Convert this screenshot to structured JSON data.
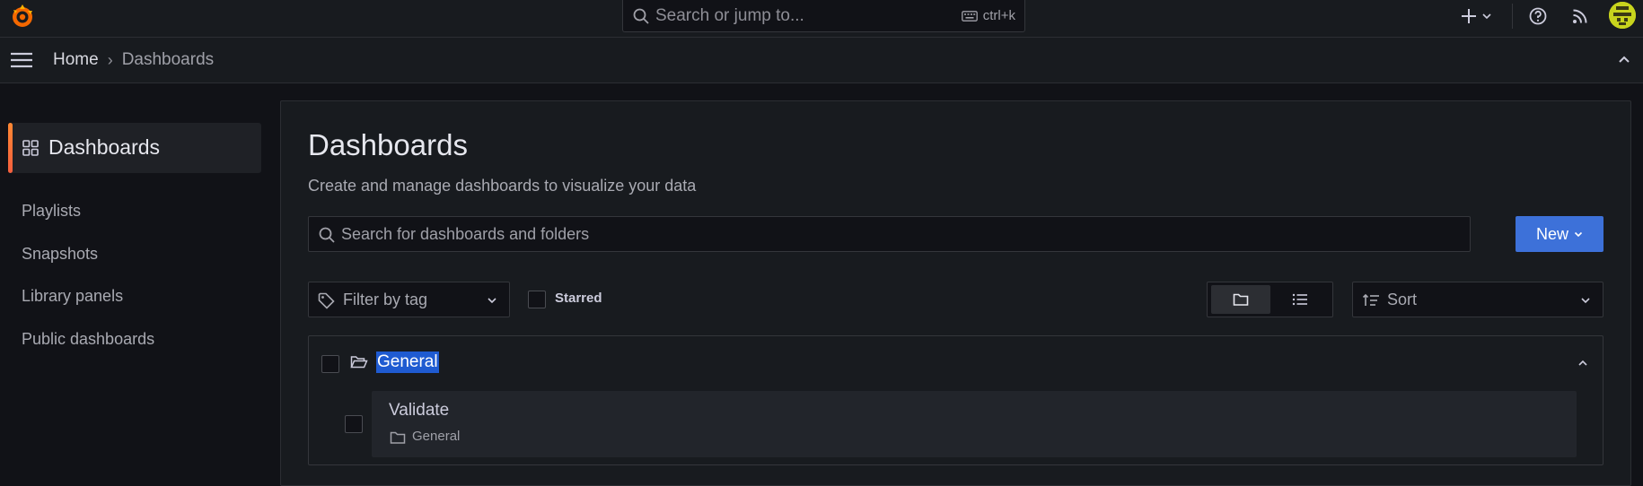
{
  "topbar": {
    "search_placeholder": "Search or jump to...",
    "shortcut": "ctrl+k",
    "icons": [
      "grafana-logo-icon",
      "keyboard-icon",
      "plus-icon",
      "help-icon",
      "rss-icon",
      "avatar"
    ]
  },
  "breadcrumb": {
    "home": "Home",
    "separator": "›",
    "current": "Dashboards"
  },
  "sidebar": {
    "active": "Dashboards",
    "items": [
      "Playlists",
      "Snapshots",
      "Library panels",
      "Public dashboards"
    ]
  },
  "main": {
    "title": "Dashboards",
    "subtitle": "Create and manage dashboards to visualize your data",
    "search_placeholder": "Search for dashboards and folders",
    "new_label": "New",
    "filter_tag_label": "Filter by tag",
    "starred_label": "Starred",
    "sort_label": "Sort",
    "view_mode": "folders"
  },
  "folders": [
    {
      "name": "General",
      "expanded": true,
      "dashboards": [
        {
          "title": "Validate",
          "folder": "General"
        }
      ]
    }
  ],
  "colors": {
    "accent": "#3d71d9",
    "active_bar": "#ff8833",
    "selection": "#1f5bd1"
  }
}
